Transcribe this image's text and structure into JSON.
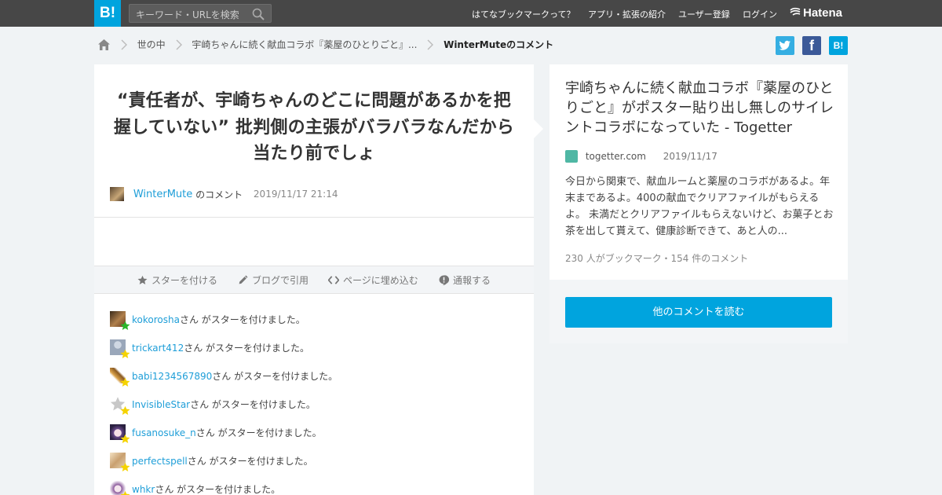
{
  "header": {
    "logo": "B!",
    "search_placeholder": "キーワード・URLを検索",
    "nav": [
      "はてなブックマークって？",
      "アプリ・拡張の紹介",
      "ユーザー登録",
      "ログイン"
    ],
    "brand": "Hatena"
  },
  "breadcrumb": {
    "items": [
      "世の中",
      "宇崎ちゃんに続く献血コラボ『薬屋のひとりごと』..."
    ],
    "current": "WinterMuteのコメント"
  },
  "share": {
    "twitter": "t",
    "facebook": "f",
    "hatena": "B!"
  },
  "comment": {
    "text": "“責任者が、宇崎ちゃんのどこに問題があるかを把握していない” 批判側の主張がバラバラなんだから当たり前でしょ",
    "author": "WinterMute",
    "author_suffix": "のコメント",
    "date": "2019/11/17 21:14"
  },
  "actions": {
    "star": "スターを付ける",
    "blog": "ブログで引用",
    "embed": "ページに埋め込む",
    "report": "通報する"
  },
  "stars": {
    "suffix": "さん がスターを付けました。",
    "users": [
      "kokorosha",
      "trickart412",
      "babi1234567890",
      "InvisibleStar",
      "fusanosuke_n",
      "perfectspell",
      "whkr"
    ]
  },
  "article": {
    "title": "宇崎ちゃんに続く献血コラボ『薬屋のひとりごと』がポスター貼り出し無しのサイレントコラボになっていた - Togetter",
    "domain": "togetter.com",
    "date": "2019/11/17",
    "excerpt": "今日から関東で、献血ルームと薬屋のコラボがあるよ。年末まであるよ。400の献血でクリアファイルがもらえるよ。 未満だとクリアファイルもらえないけど、お菓子とお茶を出して貰えて、健康診断できて、あと人の...",
    "counts": "230 人がブックマーク・154 件のコメント",
    "read_more": "他のコメントを読む"
  },
  "colors": {
    "accent": "#00a4de",
    "link": "#1e9ed8",
    "topbar": "#474747",
    "star_green": "#2bb52b",
    "star_yellow": "#f5d300"
  }
}
